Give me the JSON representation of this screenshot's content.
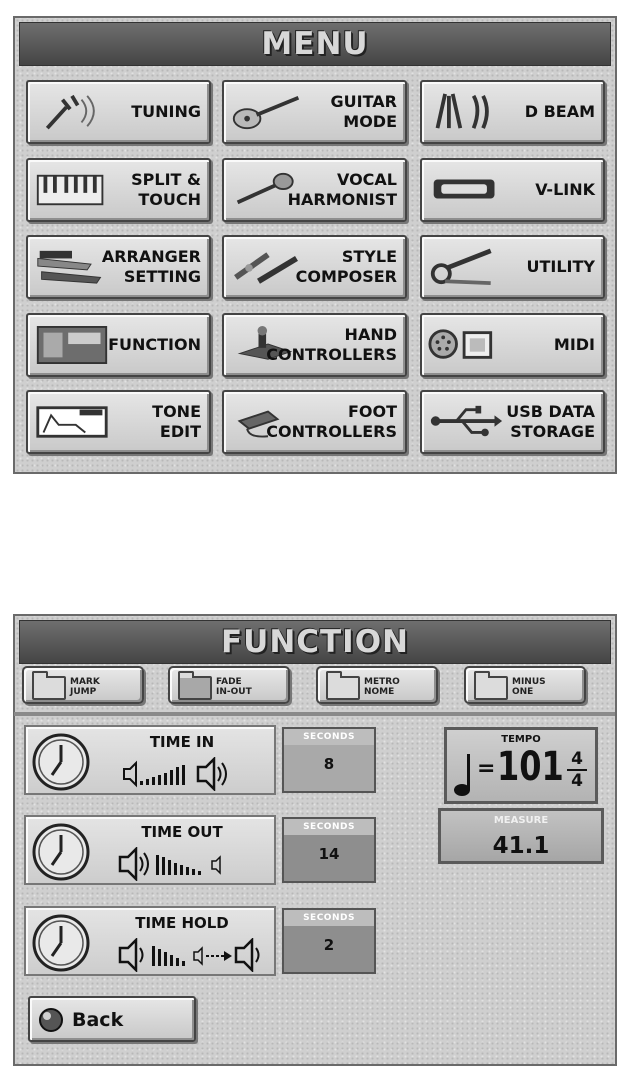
{
  "menu": {
    "title": "MENU",
    "buttons": [
      {
        "id": "tuning",
        "lines": [
          "",
          "TUNING"
        ],
        "icon": "tuning-fork-icon"
      },
      {
        "id": "guitar-mode",
        "lines": [
          "GUITAR",
          "MODE"
        ],
        "icon": "guitar-icon"
      },
      {
        "id": "d-beam",
        "lines": [
          "",
          "D BEAM"
        ],
        "icon": "d-beam-icon"
      },
      {
        "id": "split-touch",
        "lines": [
          "SPLIT &",
          "TOUCH"
        ],
        "icon": "keyboard-icon"
      },
      {
        "id": "vocal-harmonist",
        "lines": [
          "VOCAL",
          "HARMONIST"
        ],
        "icon": "microphone-icon"
      },
      {
        "id": "v-link",
        "lines": [
          "",
          "V-LINK"
        ],
        "icon": "v-link-icon"
      },
      {
        "id": "arranger-setting",
        "lines": [
          "ARRANGER",
          "SETTING"
        ],
        "icon": "arranger-icon"
      },
      {
        "id": "style-composer",
        "lines": [
          "STYLE",
          "COMPOSER"
        ],
        "icon": "style-composer-icon"
      },
      {
        "id": "utility",
        "lines": [
          "",
          "UTILITY"
        ],
        "icon": "wrench-icon"
      },
      {
        "id": "function",
        "lines": [
          "",
          "FUNCTION"
        ],
        "icon": "function-icon"
      },
      {
        "id": "hand-controllers",
        "lines": [
          "HAND",
          "CONTROLLERS"
        ],
        "icon": "hand-controller-icon"
      },
      {
        "id": "midi",
        "lines": [
          "",
          "MIDI"
        ],
        "icon": "midi-icon"
      },
      {
        "id": "tone-edit",
        "lines": [
          "TONE",
          "EDIT"
        ],
        "icon": "tone-edit-icon"
      },
      {
        "id": "foot-controllers",
        "lines": [
          "FOOT",
          "CONTROLLERS"
        ],
        "icon": "foot-pedal-icon"
      },
      {
        "id": "usb-data-storage",
        "lines": [
          "USB DATA",
          "STORAGE"
        ],
        "icon": "usb-icon"
      }
    ]
  },
  "function_screen": {
    "title": "FUNCTION",
    "tabs": [
      {
        "line1": "MARK",
        "line2": "JUMP"
      },
      {
        "line1": "FADE",
        "line2": "IN-OUT"
      },
      {
        "line1": "METRO",
        "line2": "NOME"
      },
      {
        "line1": "MINUS",
        "line2": "ONE"
      }
    ],
    "rows": [
      {
        "id": "time-in",
        "label": "TIME IN",
        "unit": "SECONDS",
        "value": "8"
      },
      {
        "id": "time-out",
        "label": "TIME OUT",
        "unit": "SECONDS",
        "value": "14"
      },
      {
        "id": "time-hold",
        "label": "TIME HOLD",
        "unit": "SECONDS",
        "value": "2"
      }
    ],
    "tempo": {
      "label": "TEMPO",
      "equals": "=",
      "value": "101",
      "sig_top": "4",
      "sig_bottom": "4"
    },
    "measure": {
      "label": "MEASURE",
      "value": "41.1"
    },
    "back_label": "Back"
  }
}
